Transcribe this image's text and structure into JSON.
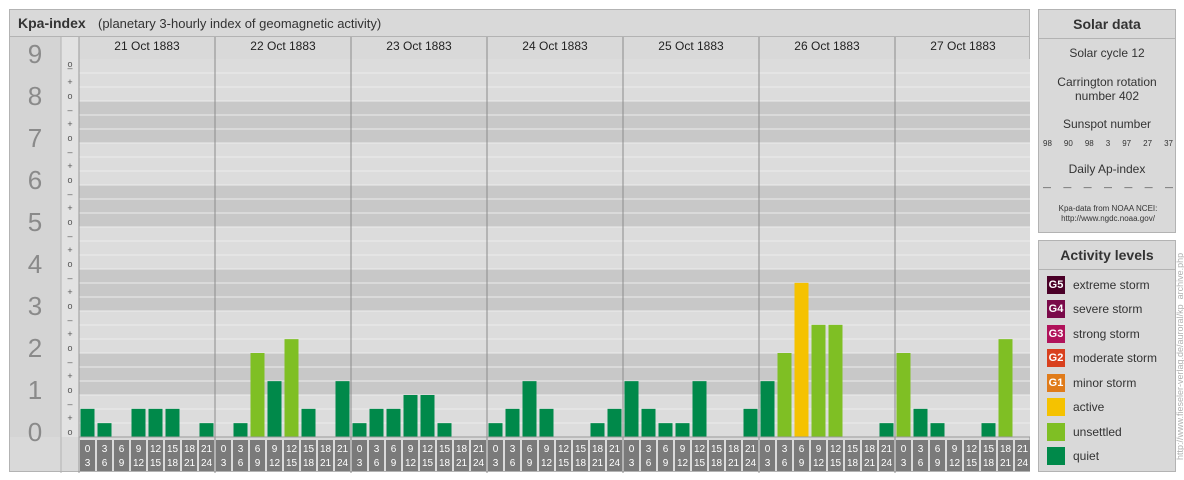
{
  "header": {
    "title": "Kpa-index",
    "subtitle": "(planetary 3-hourly index of geomagnetic activity)"
  },
  "chart_data": {
    "type": "bar",
    "ylim": [
      0,
      9
    ],
    "y_ticks": [
      "0",
      "1",
      "2",
      "3",
      "4",
      "5",
      "6",
      "7",
      "8",
      "9"
    ],
    "minor_tick_labels": [
      "+",
      "o",
      "–"
    ],
    "days": [
      "21 Oct 1883",
      "22 Oct 1883",
      "23 Oct 1883",
      "24 Oct 1883",
      "25 Oct 1883",
      "26 Oct 1883",
      "27 Oct 1883"
    ],
    "interval_starts": [
      "0",
      "3",
      "6",
      "9",
      "12",
      "15",
      "18",
      "21"
    ],
    "interval_ends": [
      "3",
      "6",
      "9",
      "12",
      "15",
      "18",
      "21",
      "24"
    ],
    "values": [
      [
        0.67,
        0.33,
        0.0,
        0.67,
        0.67,
        0.67,
        0.0,
        0.33
      ],
      [
        0.0,
        0.33,
        2.0,
        1.33,
        2.33,
        0.67,
        0.0,
        1.33
      ],
      [
        0.33,
        0.67,
        0.67,
        1.0,
        1.0,
        0.33,
        0.0,
        0.0
      ],
      [
        0.33,
        0.67,
        1.33,
        0.67,
        0.0,
        0.0,
        0.33,
        0.67
      ],
      [
        1.33,
        0.67,
        0.33,
        0.33,
        1.33,
        0.0,
        0.0,
        0.67
      ],
      [
        1.33,
        2.0,
        3.67,
        2.67,
        2.67,
        0.0,
        0.0,
        0.33
      ],
      [
        2.0,
        0.67,
        0.33,
        0.0,
        0.0,
        0.33,
        2.33,
        0.0
      ]
    ],
    "level_colors": {
      "quiet": "#00894a",
      "unsettled": "#7fbf24",
      "active": "#f5c200",
      "minor_storm": "#e07b1a",
      "moderate_storm": "#d9401e",
      "strong_storm": "#b0125a",
      "severe_storm": "#7a0a4a",
      "extreme_storm": "#4a0027"
    },
    "grid": true
  },
  "solar": {
    "title": "Solar data",
    "cycle": "Solar cycle 12",
    "carrington_line1": "Carrington rotation",
    "carrington_line2": "number 402",
    "sunspot_title": "Sunspot number",
    "sunspot_values": [
      "98",
      "90",
      "98",
      "3",
      "97",
      "27",
      "37"
    ],
    "ap_title": "Daily Ap-index",
    "ap_values": [
      "—",
      "—",
      "—",
      "—",
      "—",
      "—",
      "—"
    ],
    "note_line1": "Kpa-data from NOAA NCEI:",
    "note_line2": "http://www.ngdc.noaa.gov/"
  },
  "activity": {
    "title": "Activity levels",
    "levels": [
      {
        "badge": "G5",
        "label": "extreme storm",
        "color": "#4a0027"
      },
      {
        "badge": "G4",
        "label": "severe storm",
        "color": "#7a0a4a"
      },
      {
        "badge": "G3",
        "label": "strong storm",
        "color": "#b0125a"
      },
      {
        "badge": "G2",
        "label": "moderate storm",
        "color": "#d9401e"
      },
      {
        "badge": "G1",
        "label": "minor storm",
        "color": "#e07b1a"
      },
      {
        "badge": "",
        "label": "active",
        "color": "#f5c200"
      },
      {
        "badge": "",
        "label": "unsettled",
        "color": "#7fbf24"
      },
      {
        "badge": "",
        "label": "quiet",
        "color": "#00894a"
      }
    ]
  },
  "watermark": "http://www.fieseler-verlag.de/auroral/kp_archive.php"
}
